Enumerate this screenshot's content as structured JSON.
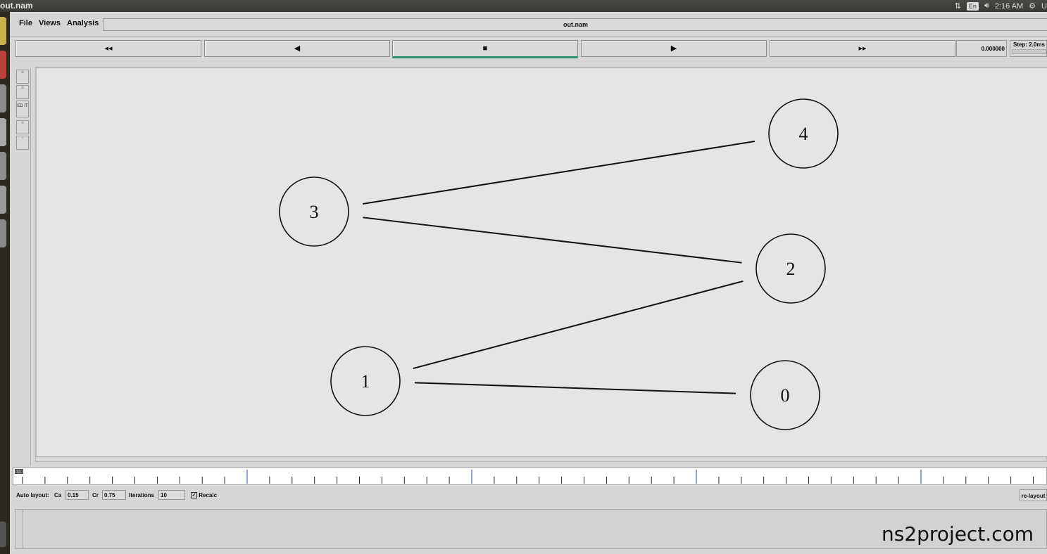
{
  "window": {
    "title": "out.nam"
  },
  "system_tray": {
    "lang": "En",
    "time": "2:16 AM",
    "last": "U"
  },
  "menu": {
    "file": "File",
    "views": "Views",
    "analysis": "Analysis"
  },
  "file_name": "out.nam",
  "playback": {
    "rewind": "◂◂",
    "back": "◀",
    "stop": "■",
    "play": "▶",
    "fast_forward": "▸▸",
    "time": "0.000000",
    "step_label": "Step: 2.0ms"
  },
  "edit_tool": "ED IT",
  "topology": {
    "nodes": [
      {
        "id": "0",
        "label": "0"
      },
      {
        "id": "1",
        "label": "1"
      },
      {
        "id": "2",
        "label": "2"
      },
      {
        "id": "3",
        "label": "3"
      },
      {
        "id": "4",
        "label": "4"
      }
    ],
    "links": [
      {
        "from": "3",
        "to": "4"
      },
      {
        "from": "3",
        "to": "2"
      },
      {
        "from": "1",
        "to": "2"
      },
      {
        "from": "1",
        "to": "0"
      }
    ]
  },
  "auto_layout": {
    "label": "Auto layout:",
    "ca_label": "Ca",
    "ca_value": "0.15",
    "cr_label": "Cr",
    "cr_value": "0.75",
    "iterations_label": "Iterations",
    "iterations_value": "10",
    "recalc_label": "Recalc",
    "recalc_checked": true,
    "relayout_label": "re-layout"
  },
  "watermark": "ns2project.com"
}
